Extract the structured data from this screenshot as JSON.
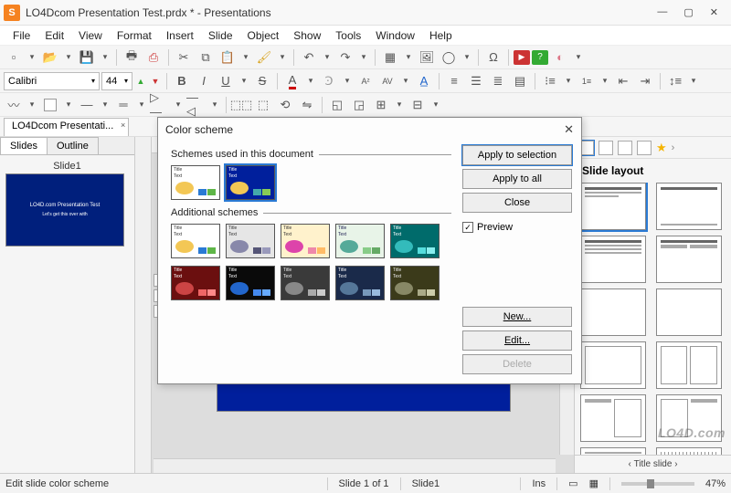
{
  "window": {
    "title": "LO4Dcom Presentation Test.prdx * - Presentations"
  },
  "menu": [
    "File",
    "Edit",
    "View",
    "Format",
    "Insert",
    "Slide",
    "Object",
    "Show",
    "Tools",
    "Window",
    "Help"
  ],
  "font": {
    "name": "Calibri",
    "size": "44"
  },
  "doctab": {
    "label": "LO4Dcom Presentati...",
    "close": "×"
  },
  "sidebar": {
    "tabs": [
      "Slides",
      "Outline"
    ],
    "slide_label": "Slide1",
    "thumb_title": "LO4D.com Presentation Test",
    "thumb_sub": "Let's get this over with"
  },
  "dialog": {
    "title": "Color scheme",
    "group1": "Schemes used in this document",
    "group2": "Additional schemes",
    "buttons": {
      "apply_sel": "Apply to selection",
      "apply_all": "Apply to all",
      "close": "Close",
      "new": "New...",
      "edit": "Edit...",
      "delete": "Delete"
    },
    "preview": "Preview",
    "tiny_title": "Title",
    "tiny_text": "Text"
  },
  "rightpanel": {
    "title": "Slide layout",
    "footer": "Title slide"
  },
  "status": {
    "msg": "Edit slide color scheme",
    "slide": "Slide 1 of 1",
    "name": "Slide1",
    "ins": "Ins",
    "zoom": "47%"
  },
  "watermark": "LO4D.com",
  "scheme_colors": {
    "used": [
      {
        "bg": "#ffffff",
        "fg": "#333",
        "chip": "#f3c755",
        "s1": "#2a7ad4",
        "s2": "#5fb648"
      },
      {
        "bg": "#001f9c",
        "fg": "#fff",
        "chip": "#f3c755",
        "s1": "#4aa",
        "s2": "#8c5"
      }
    ],
    "additional": [
      {
        "bg": "#ffffff",
        "fg": "#333",
        "chip": "#f3c755",
        "s1": "#2a7ad4",
        "s2": "#5fb648"
      },
      {
        "bg": "#e6e6e6",
        "fg": "#333",
        "chip": "#88a",
        "s1": "#557",
        "s2": "#99b"
      },
      {
        "bg": "#fff2cc",
        "fg": "#333",
        "chip": "#d4a",
        "s1": "#e8a",
        "s2": "#fb6"
      },
      {
        "bg": "#e8f4e8",
        "fg": "#225",
        "chip": "#5a9",
        "s1": "#8c8",
        "s2": "#6a6"
      },
      {
        "bg": "#006b6b",
        "fg": "#fff",
        "chip": "#3bb",
        "s1": "#5dd",
        "s2": "#8ee"
      },
      {
        "bg": "#6b0f0f",
        "fg": "#fff",
        "chip": "#c44",
        "s1": "#e66",
        "s2": "#f88"
      },
      {
        "bg": "#0a0a0a",
        "fg": "#fff",
        "chip": "#26c",
        "s1": "#48e",
        "s2": "#6af"
      },
      {
        "bg": "#3a3a3a",
        "fg": "#eee",
        "chip": "#888",
        "s1": "#aaa",
        "s2": "#ccc"
      },
      {
        "bg": "#1a2a4a",
        "fg": "#fff",
        "chip": "#579",
        "s1": "#79b",
        "s2": "#9bd"
      },
      {
        "bg": "#3b3a1a",
        "fg": "#eee",
        "chip": "#886",
        "s1": "#aa8",
        "s2": "#cca"
      }
    ]
  }
}
